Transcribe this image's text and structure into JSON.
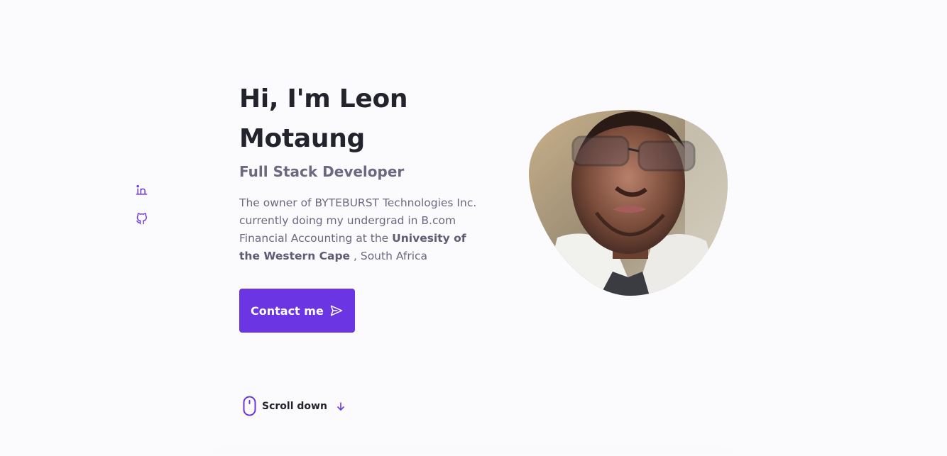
{
  "social": {
    "linkedin_icon": "linkedin-icon",
    "github_icon": "github-icon"
  },
  "hero": {
    "title_line1": "Hi, I'm Leon",
    "title_line2": "Motaung",
    "subtitle": "Full Stack Developer",
    "desc_part1": "The owner of BYTEBURST Technologies Inc. currently doing my undergrad in B.com Financial Accounting at the ",
    "desc_bold": "Univesity of the Western Cape",
    "desc_part2": " , South Africa",
    "contact_label": "Contact me",
    "contact_icon": "send-icon"
  },
  "scroll": {
    "label": "Scroll down",
    "mouse_icon": "mouse-icon",
    "arrow_icon": "arrow-down-icon"
  },
  "colors": {
    "accent": "#6b35e3",
    "text_title": "#23232e",
    "text_body": "#6b6880",
    "background": "#fbfbfe"
  }
}
